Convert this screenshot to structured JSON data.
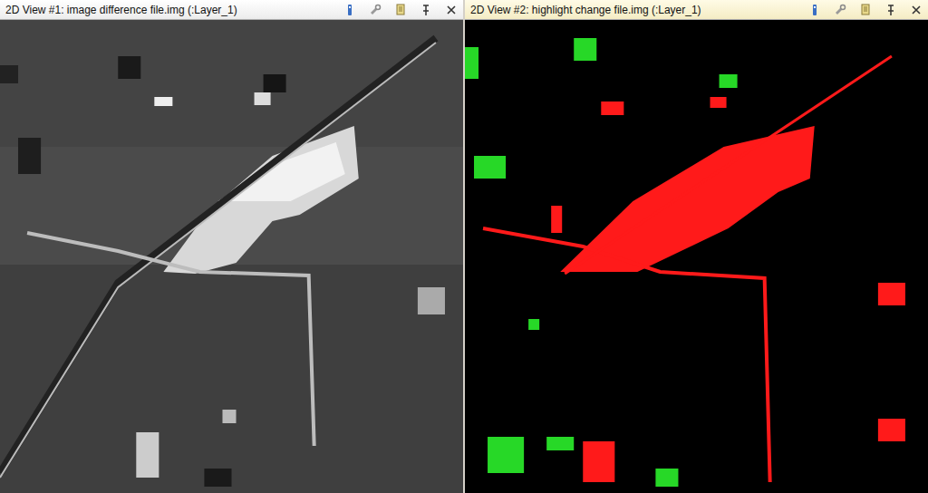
{
  "views": [
    {
      "title": "2D View #1: image difference file.img (:Layer_1)",
      "active": false,
      "kind": "grayscale"
    },
    {
      "title": "2D View #2: highlight change file.img (:Layer_1)",
      "active": true,
      "kind": "change-map"
    }
  ]
}
